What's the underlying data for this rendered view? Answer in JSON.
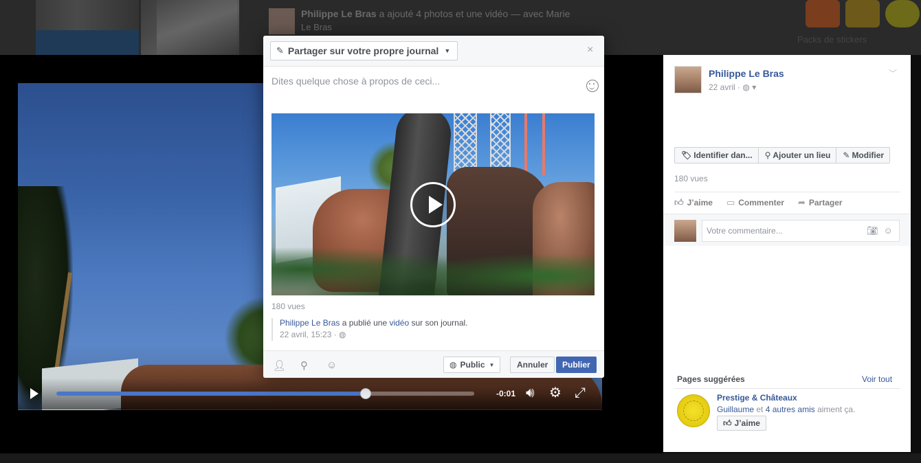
{
  "background_feed": {
    "post_author": "Philippe Le Bras",
    "post_text": "a ajouté 4 photos et une vidéo — avec Marie",
    "post_text_line2": "Le Bras",
    "sticker_caption": "Packs de stickers"
  },
  "video": {
    "time_remaining": "-0:01",
    "progress": 0.74
  },
  "side_panel": {
    "author_name": "Philippe Le Bras",
    "date": "22 avril",
    "audience_icon": "globe-icon",
    "buttons": [
      {
        "label": "Identifier dan...",
        "icon": "tag-icon"
      },
      {
        "label": "Ajouter un lieu",
        "icon": "location-pin-icon"
      },
      {
        "label": "Modifier",
        "icon": "pencil-icon"
      }
    ],
    "views": "180 vues",
    "actions": [
      {
        "label": "J’aime",
        "icon": "thumbs-up-icon"
      },
      {
        "label": "Commenter",
        "icon": "comment-icon"
      },
      {
        "label": "Partager",
        "icon": "share-arrow-icon"
      }
    ],
    "comment_placeholder": "Votre commentaire...",
    "suggested_pages_title": "Pages suggérées",
    "see_all": "Voir tout",
    "suggested_page": {
      "name": "Prestige & Châteaux",
      "friend": "Guillaume",
      "connector": " et ",
      "others": "4 autres amis",
      "suffix": " aiment ça.",
      "like_label": "J’aime"
    }
  },
  "share_dialog": {
    "share_target": "Partager sur votre propre journal",
    "close_glyph": "×",
    "status_placeholder": "Dites quelque chose à propos de ceci...",
    "views": "180 vues",
    "quote": {
      "author": "Philippe Le Bras",
      "text_before": " a publié une ",
      "link": "vidéo",
      "text_after": " sur son journal.",
      "timestamp": "22 avril, 15:23 · "
    },
    "privacy": "Public",
    "cancel": "Annuler",
    "publish": "Publier"
  },
  "colors": {
    "brand_blue": "#4267b2",
    "link_blue": "#365899",
    "progress_blue": "#4a76c7"
  }
}
